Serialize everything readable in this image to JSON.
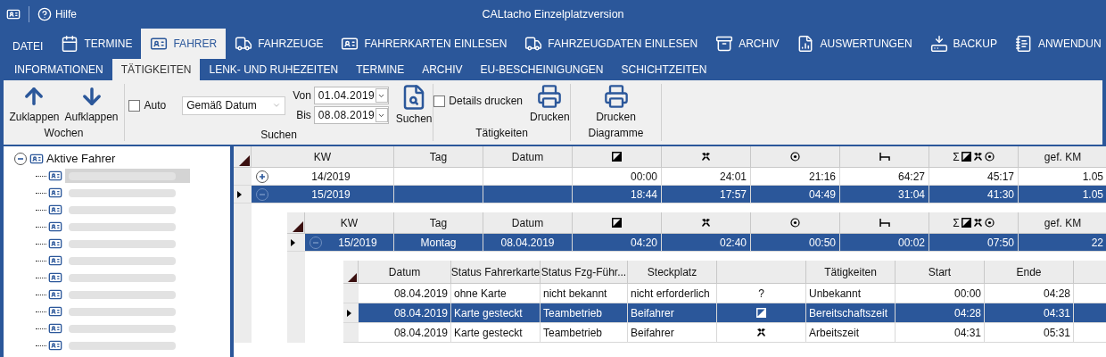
{
  "window": {
    "title": "CALtacho Einzelplatzversion",
    "help": "Hilfe"
  },
  "main_tabs": [
    {
      "label": "DATEI",
      "kind": "file",
      "selected": false
    },
    {
      "label": "TERMINE",
      "kind": "calendar",
      "selected": false
    },
    {
      "label": "FAHRER",
      "kind": "card",
      "selected": true
    },
    {
      "label": "FAHRZEUGE",
      "kind": "truck",
      "selected": false
    },
    {
      "label": "FAHRERKARTEN EINLESEN",
      "kind": "card-import",
      "selected": false
    },
    {
      "label": "FAHRZEUGDATEN EINLESEN",
      "kind": "truck-import",
      "selected": false
    },
    {
      "label": "ARCHIV",
      "kind": "archive",
      "selected": false
    },
    {
      "label": "AUSWERTUNGEN",
      "kind": "report",
      "selected": false
    },
    {
      "label": "BACKUP",
      "kind": "backup",
      "selected": false
    },
    {
      "label": "ANWENDUN",
      "kind": "notes",
      "selected": false
    }
  ],
  "sub_tabs": [
    {
      "label": "INFORMATIONEN",
      "selected": false
    },
    {
      "label": "TÄTIGKEITEN",
      "selected": true
    },
    {
      "label": "LENK- UND RUHEZEITEN",
      "selected": false
    },
    {
      "label": "TERMINE",
      "selected": false
    },
    {
      "label": "ARCHIV",
      "selected": false
    },
    {
      "label": "EU-BESCHEINIGUNGEN",
      "selected": false
    },
    {
      "label": "SCHICHTZEITEN",
      "selected": false
    }
  ],
  "ribbon": {
    "wochen": {
      "label": "Wochen",
      "collapse": "Zuklappen",
      "expand": "Aufklappen"
    },
    "suchen": {
      "label": "Suchen",
      "auto": {
        "label": "Auto",
        "checked": false
      },
      "mode": "Gemäß Datum",
      "from_label": "Von",
      "from": "01.04.2019",
      "to_label": "Bis",
      "to": "08.08.2019",
      "button": "Suchen"
    },
    "taetigkeiten": {
      "label": "Tätigkeiten",
      "details": {
        "label": "Details drucken",
        "checked": false
      },
      "button": "Drucken"
    },
    "diagramme": {
      "label": "Diagramme",
      "button": "Drucken"
    }
  },
  "tree": {
    "label": "Aktive Fahrer",
    "expanded": true,
    "children": [
      {
        "kind": "redacted",
        "selected": true
      },
      {
        "kind": "redacted",
        "selected": false
      },
      {
        "kind": "redacted",
        "selected": false
      },
      {
        "kind": "redacted",
        "selected": false
      },
      {
        "kind": "redacted",
        "selected": false
      },
      {
        "kind": "redacted",
        "selected": false
      },
      {
        "kind": "redacted",
        "selected": false
      },
      {
        "kind": "redacted",
        "selected": false
      },
      {
        "kind": "redacted",
        "selected": false
      },
      {
        "kind": "redacted",
        "selected": false
      },
      {
        "kind": "redacted",
        "selected": false
      }
    ]
  },
  "weeks_table": {
    "columns": [
      {
        "kind": "text",
        "label": "KW"
      },
      {
        "kind": "text",
        "label": "Tag"
      },
      {
        "kind": "text",
        "label": "Datum"
      },
      {
        "kind": "standby"
      },
      {
        "kind": "work"
      },
      {
        "kind": "driving"
      },
      {
        "kind": "rest"
      },
      {
        "kind": "sum",
        "label": "Σ"
      },
      {
        "kind": "text",
        "label": "gef. KM"
      }
    ],
    "rows": [
      {
        "expanded": false,
        "selected": false,
        "cells": [
          "14/2019",
          "",
          "",
          "00:00",
          "24:01",
          "21:16",
          "64:27",
          "45:17",
          "1.05"
        ]
      },
      {
        "expanded": true,
        "selected": true,
        "cells": [
          "15/2019",
          "",
          "",
          "18:44",
          "17:57",
          "04:49",
          "31:04",
          "41:30",
          "1.05"
        ]
      }
    ]
  },
  "days_table": {
    "columns": [
      {
        "kind": "text",
        "label": "KW"
      },
      {
        "kind": "text",
        "label": "Tag"
      },
      {
        "kind": "text",
        "label": "Datum"
      },
      {
        "kind": "standby"
      },
      {
        "kind": "work"
      },
      {
        "kind": "driving"
      },
      {
        "kind": "rest"
      },
      {
        "kind": "sum",
        "label": "Σ"
      },
      {
        "kind": "text",
        "label": "gef. KM"
      }
    ],
    "rows": [
      {
        "expanded": true,
        "selected": true,
        "cells": [
          "15/2019",
          "Montag",
          "08.04.2019",
          "04:20",
          "02:40",
          "00:50",
          "00:02",
          "07:50",
          "22"
        ]
      }
    ]
  },
  "activities_table": {
    "columns": [
      "Datum",
      "Status Fahrerkarte",
      "Status Fzg-Führ...",
      "Steckplatz",
      "",
      "Tätigkeiten",
      "Start",
      "Ende"
    ],
    "rows": [
      {
        "selected": false,
        "date": "08.04.2019",
        "card": "ohne Karte",
        "driver": "nicht bekannt",
        "slot": "nicht erforderlich",
        "activity": {
          "kind": "text",
          "text": "?"
        },
        "name": "Unbekannt",
        "start": "00:00",
        "end": "04:28"
      },
      {
        "selected": true,
        "date": "08.04.2019",
        "card": "Karte gesteckt",
        "driver": "Teambetrieb",
        "slot": "Beifahrer",
        "activity": {
          "kind": "standby"
        },
        "name": "Bereitschaftszeit",
        "start": "04:28",
        "end": "04:31"
      },
      {
        "selected": false,
        "date": "08.04.2019",
        "card": "Karte gesteckt",
        "driver": "Teambetrieb",
        "slot": "Beifahrer",
        "activity": {
          "kind": "work"
        },
        "name": "Arbeitszeit",
        "start": "04:31",
        "end": "05:31"
      }
    ]
  }
}
